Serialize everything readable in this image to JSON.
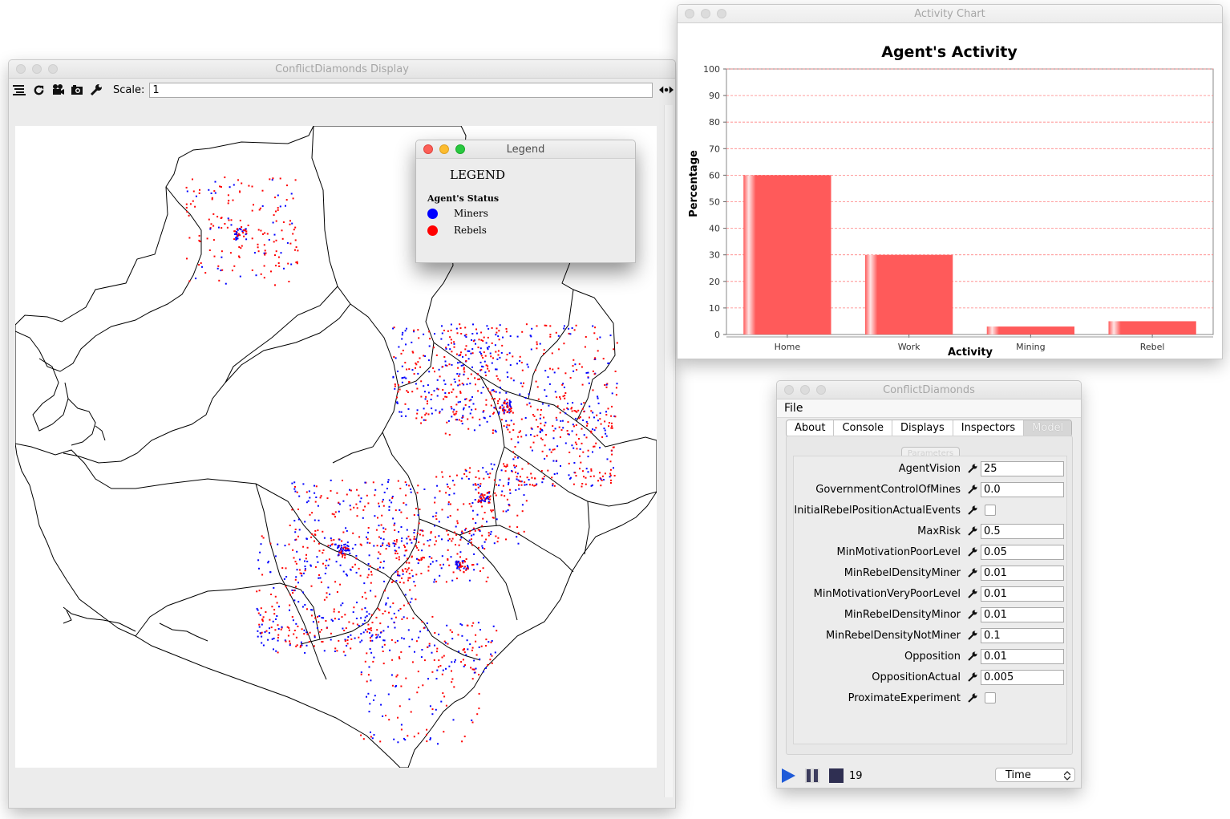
{
  "display_window": {
    "title": "ConflictDiamonds Display",
    "scale_label": "Scale:",
    "scale_value": "1",
    "toolbar_icons": [
      "layers-icon",
      "refresh-icon",
      "movie-camera-icon",
      "snapshot-camera-icon",
      "wrench-icon"
    ],
    "map": {
      "background": "#ffffff",
      "boundary_color": "#000000",
      "legend_colors": {
        "miners": "#0000ff",
        "rebels": "#ff0000"
      }
    }
  },
  "legend_window": {
    "title": "Legend",
    "heading": "LEGEND",
    "subheading": "Agent's Status",
    "items": [
      {
        "label": "Miners",
        "color": "#0000ff"
      },
      {
        "label": "Rebels",
        "color": "#ff0000"
      }
    ]
  },
  "chart_window": {
    "title": "Activity Chart"
  },
  "chart_data": {
    "type": "bar",
    "title": "Agent's Activity",
    "xlabel": "Activity",
    "ylabel": "Percentage",
    "categories": [
      "Home",
      "Work",
      "Mining",
      "Rebel"
    ],
    "values": [
      60,
      30,
      3,
      5
    ],
    "ylim": [
      0,
      100
    ],
    "yticks": [
      0,
      10,
      20,
      30,
      40,
      50,
      60,
      70,
      80,
      90,
      100
    ],
    "grid": true,
    "bar_color": "#ff5a5a",
    "grid_color": "#ff8080"
  },
  "controller_window": {
    "title": "ConflictDiamonds",
    "menu": [
      "File"
    ],
    "tabs": [
      "About",
      "Console",
      "Displays",
      "Inspectors",
      "Model"
    ],
    "selected_tab": "Model",
    "parameters_button": "Parameters",
    "parameters": [
      {
        "name": "AgentVision",
        "value": "25",
        "type": "text"
      },
      {
        "name": "GovernmentControlOfMines",
        "value": "0.0",
        "type": "text"
      },
      {
        "name": "InitialRebelPositionActualEvents",
        "value": "",
        "type": "checkbox"
      },
      {
        "name": "MaxRisk",
        "value": "0.5",
        "type": "text"
      },
      {
        "name": "MinMotivationPoorLevel",
        "value": "0.05",
        "type": "text"
      },
      {
        "name": "MinRebelDensityMiner",
        "value": "0.01",
        "type": "text"
      },
      {
        "name": "MinMotivationVeryPoorLevel",
        "value": "0.01",
        "type": "text"
      },
      {
        "name": "MinRebelDensityMinor",
        "value": "0.01",
        "type": "text"
      },
      {
        "name": "MinRebelDensityNotMiner",
        "value": "0.1",
        "type": "text"
      },
      {
        "name": "Opposition",
        "value": "0.01",
        "type": "text"
      },
      {
        "name": "OppositionActual",
        "value": "0.005",
        "type": "text"
      },
      {
        "name": "ProximateExperiment",
        "value": "",
        "type": "checkbox"
      }
    ],
    "step_count": "19",
    "time_selector": "Time",
    "play_color": "#1f5bd8",
    "pause_color": "#3b3b5c",
    "stop_color": "#2f2f52"
  }
}
